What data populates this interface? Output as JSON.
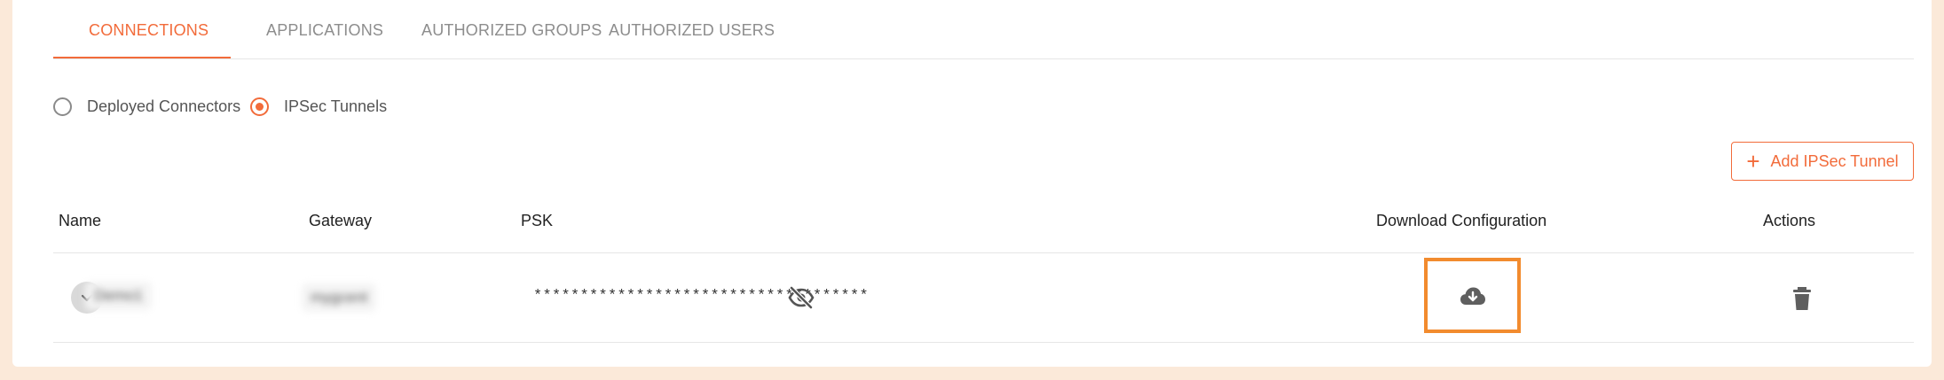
{
  "tabs": [
    {
      "label": "CONNECTIONS",
      "active": true
    },
    {
      "label": "APPLICATIONS",
      "active": false
    },
    {
      "label": "AUTHORIZED GROUPS",
      "active": false
    },
    {
      "label": "AUTHORIZED USERS",
      "active": false
    }
  ],
  "connector_type": {
    "options": [
      {
        "label": "Deployed Connectors",
        "checked": false
      },
      {
        "label": "IPSec Tunnels",
        "checked": true
      }
    ]
  },
  "toolbar": {
    "add_label": "Add IPSec Tunnel"
  },
  "table": {
    "columns": [
      "Name",
      "Gateway",
      "PSK",
      "Download Configuration",
      "Actions"
    ],
    "rows": [
      {
        "name": "Demo1",
        "gateway": "mygcent",
        "psk": "************************************"
      }
    ]
  },
  "colors": {
    "accent": "#f26b3a",
    "highlight_border": "#f28b2e",
    "page_background": "#fbe9d9"
  },
  "icons": {
    "add": "plus-icon",
    "expand": "chevron-down-icon",
    "reveal": "eye-off-icon",
    "download": "cloud-download-icon",
    "delete": "trash-icon"
  }
}
